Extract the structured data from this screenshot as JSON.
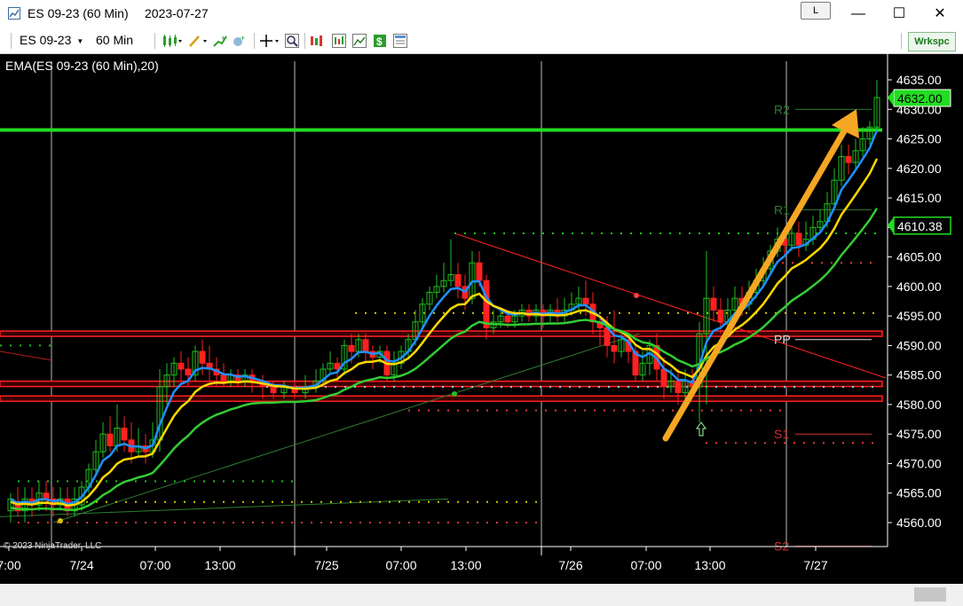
{
  "window": {
    "title": "ES 09-23 (60 Min)",
    "date": "2023-07-27",
    "link_button": "L",
    "minimize": "—",
    "maximize": "☐",
    "close": "✕"
  },
  "toolbar": {
    "instrument": "ES 09-23",
    "interval": "60 Min",
    "workspace_button": "Wrkspc",
    "icons": [
      "bar-type-icon",
      "drawing-tool-icon",
      "indicators-icon",
      "strategies-icon",
      "crosshair-icon",
      "zoom-icon",
      "chart-trader-icon",
      "data-box-icon",
      "templates-icon",
      "price-marker-icon",
      "properties-icon"
    ]
  },
  "chart": {
    "indicator_label": "EMA(ES 09-23 (60 Min),20)",
    "copyright": "© 2023 NinjaTrader, LLC",
    "price_labels": [
      "4635.00",
      "4630.00",
      "4625.00",
      "4620.00",
      "4615.00",
      "4610.00",
      "4605.00",
      "4600.00",
      "4595.00",
      "4590.00",
      "4585.00",
      "4580.00",
      "4575.00",
      "4570.00",
      "4565.00",
      "4560.00"
    ],
    "price_values": [
      4635,
      4630,
      4625,
      4620,
      4615,
      4610,
      4605,
      4600,
      4595,
      4590,
      4585,
      4580,
      4575,
      4570,
      4565,
      4560
    ],
    "time_labels": [
      "7:00",
      "7/24",
      "07:00",
      "13:00",
      "7/25",
      "07:00",
      "13:00",
      "7/26",
      "07:00",
      "13:00",
      "7/27"
    ],
    "current_price": "4632.00",
    "marker_price": "4610.38",
    "pivot_labels": {
      "r2": "R2",
      "r1": "R1",
      "pp": "PP",
      "s1": "S1",
      "s2": "S2"
    },
    "colors": {
      "background": "#000000",
      "ema_fast": "#1e90ff",
      "ema_mid": "#ffd700",
      "ema_slow": "#32cd32",
      "support_lines": "#ff2020",
      "resistance_line": "#22dd22",
      "arrow": "#f5a623",
      "current_price_bg": "#22dd22"
    }
  }
}
